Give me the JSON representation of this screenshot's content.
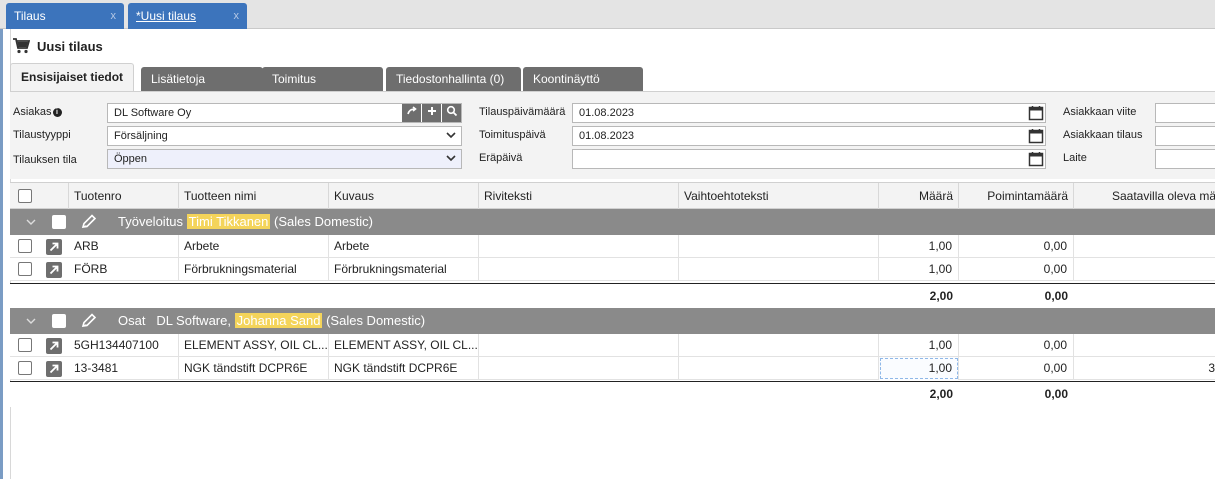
{
  "window_tabs": [
    {
      "label": "Tilaus",
      "close": "x"
    },
    {
      "label": "*Uusi tilaus",
      "close": "x"
    }
  ],
  "page": {
    "title": "Uusi tilaus",
    "icon": "cart-icon"
  },
  "tabs": [
    "Ensisijaiset tiedot",
    "Lisätietoja",
    "Toimitus",
    "Tiedostonhallinta (0)",
    "Koontinäyttö"
  ],
  "form": {
    "customer": {
      "label": "Asiakas",
      "value": "DL Software Oy"
    },
    "order_type": {
      "label": "Tilaustyyppi",
      "value": "Försäljning"
    },
    "order_status": {
      "label": "Tilauksen tila",
      "value": "Öppen"
    },
    "order_date": {
      "label": "Tilauspäivämäärä",
      "value": "01.08.2023"
    },
    "delivery_date": {
      "label": "Toimituspäivä",
      "value": "01.08.2023"
    },
    "due_date": {
      "label": "Eräpäivä",
      "value": ""
    },
    "customer_ref": {
      "label": "Asiakkaan viite",
      "value": ""
    },
    "customer_order": {
      "label": "Asiakkaan tilaus",
      "value": ""
    },
    "device": {
      "label": "Laite",
      "value": ""
    }
  },
  "grid": {
    "columns": [
      "Tuotenro",
      "Tuotteen nimi",
      "Kuvaus",
      "Riviteksti",
      "Vaihtoehtoteksti",
      "Määrä",
      "Poimintamäärä",
      "Saatavilla oleva mä"
    ],
    "groups": [
      {
        "prefix": "Työveloitus",
        "company": "",
        "person": "Timi Tikkanen",
        "suffix": "(Sales Domestic)",
        "rows": [
          {
            "no": "ARB",
            "name": "Arbete",
            "desc": "Arbete",
            "qty": "1,00",
            "pick": "0,00",
            "avail": ""
          },
          {
            "no": "FÖRB",
            "name": "Förbrukningsmaterial",
            "desc": "Förbrukningsmaterial",
            "qty": "1,00",
            "pick": "0,00",
            "avail": ""
          }
        ],
        "sum_qty": "2,00",
        "sum_pick": "0,00"
      },
      {
        "prefix": "Osat",
        "company": "DL Software,",
        "person": "Johanna Sand",
        "suffix": "(Sales Domestic)",
        "rows": [
          {
            "no": "5GH134407100",
            "name": "ELEMENT ASSY, OIL CL...",
            "desc": "ELEMENT ASSY, OIL CL...",
            "qty": "1,00",
            "pick": "0,00",
            "avail": ""
          },
          {
            "no": "13-3481",
            "name": "NGK tändstift DCPR6E",
            "desc": "NGK tändstift DCPR6E",
            "qty": "1,00",
            "pick": "0,00",
            "avail": "3"
          }
        ],
        "sum_qty": "2,00",
        "sum_pick": "0,00"
      }
    ]
  },
  "colors": {
    "tab_blue": "#3c74bc",
    "gray_bar": "#8a8a8a",
    "highlight": "#f4d45a"
  }
}
